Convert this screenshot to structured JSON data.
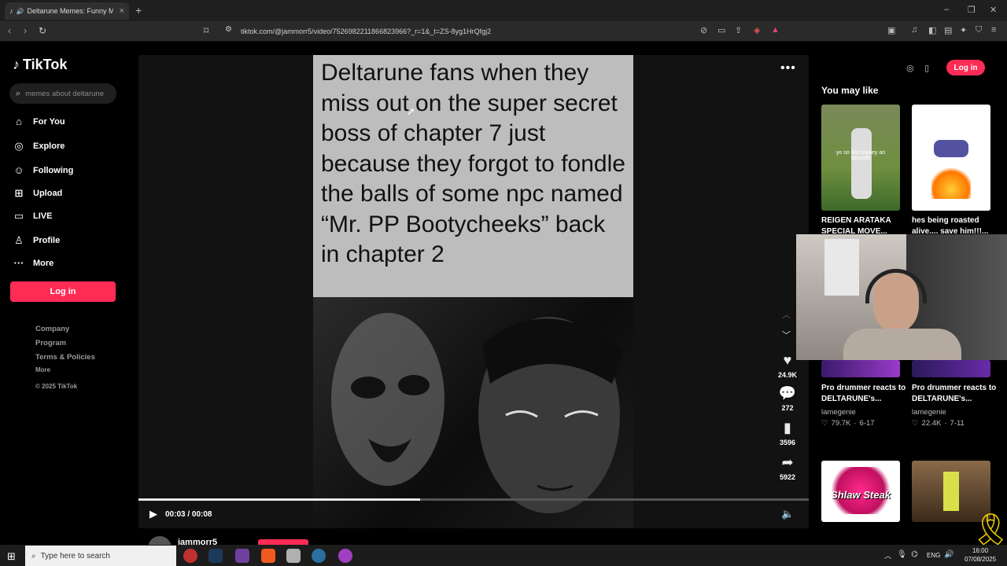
{
  "browser": {
    "tab_title": "Deltarune Memes: Funny Me...",
    "url": "tiktok.com/@jammorr5/video/7526982211866823966?_r=1&_t=ZS-8yg1HrQfgj2"
  },
  "tiktok": {
    "logo": "TikTok",
    "search_placeholder": "memes about deltarune",
    "nav": [
      "For You",
      "Explore",
      "Following",
      "Upload",
      "LIVE",
      "Profile",
      "More"
    ],
    "login": "Log in",
    "footer": [
      "Company",
      "Program",
      "Terms & Policies",
      "More",
      "© 2025 TikTok"
    ]
  },
  "video": {
    "caption": "Deltarune fans when they miss out on the super secret boss of chapter 7 just because they forgot to fondle the balls of some npc named “Mr. PP Bootycheeks” back in chapter 2",
    "time": "00:03 / 00:08",
    "progress": 0.42,
    "likes": "24.9K",
    "comments": "272",
    "saves": "3596",
    "shares": "5922",
    "author": "jammorr5"
  },
  "sidebar": {
    "heading": "You may like",
    "cards": [
      {
        "title": "REIGEN ARATAKA SPECIAL MOVE...",
        "overlay": "yo so like lowkey an episode"
      },
      {
        "title": "hes being roasted alive.... save him!!!..."
      },
      {
        "title": "Pro drummer reacts to DELTARUNE's...",
        "author": "lamegenie",
        "likes": "79.7K",
        "date": "6-17"
      },
      {
        "title": "Pro drummer reacts to DELTARUNE's...",
        "author": "lamegenie",
        "likes": "22.4K",
        "date": "7-11"
      },
      {
        "overlay": "Shlaw Steak"
      }
    ]
  },
  "taskbar": {
    "search_placeholder": "Type here to search",
    "lang": "ENG",
    "time": "16:00",
    "date": "07/08/2025"
  },
  "colors": {
    "accent": "#fe2c55"
  }
}
